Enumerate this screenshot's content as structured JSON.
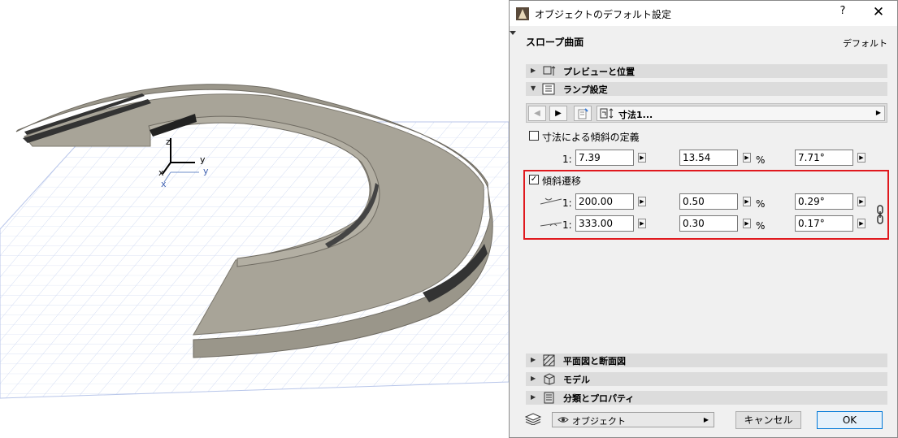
{
  "dialog": {
    "title": "オブジェクトのデフォルト設定",
    "help": "?",
    "close": "✕",
    "object_name": "スロープ曲面",
    "default_label": "デフォルト"
  },
  "sections": {
    "preview": "プレビューと位置",
    "ramp": "ランプ設定",
    "plan": "平面図と断面図",
    "model": "モデル",
    "classification": "分類とプロパティ"
  },
  "nav": {
    "prev": "◀",
    "next": "▶",
    "page_label": "寸法1...",
    "caret": "▶"
  },
  "slope_definition": {
    "checkbox_checked": false,
    "label": "寸法による傾斜の定義",
    "ratio_prefix": "1:",
    "ratio": "7.39",
    "percent": "13.54",
    "percent_unit": "%",
    "angle": "7.71°"
  },
  "transition": {
    "checkbox_checked": true,
    "label": "傾斜遷移",
    "rows": [
      {
        "ratio_prefix": "1:",
        "ratio": "200.00",
        "percent": "0.50",
        "percent_unit": "%",
        "angle": "0.29°"
      },
      {
        "ratio_prefix": "1:",
        "ratio": "333.00",
        "percent": "0.30",
        "percent_unit": "%",
        "angle": "0.17°"
      }
    ]
  },
  "footer": {
    "object_select": "オブジェクト",
    "cancel": "キャンセル",
    "ok": "OK"
  },
  "viewport": {
    "axis_z": "z",
    "axis_y": "y",
    "axis_x": "x",
    "axis_y2": "y",
    "axis_x2": "x"
  },
  "colors": {
    "highlight_border": "#e0191e",
    "grid": "#c8d4f0",
    "ramp_stone": "#9a968a"
  }
}
